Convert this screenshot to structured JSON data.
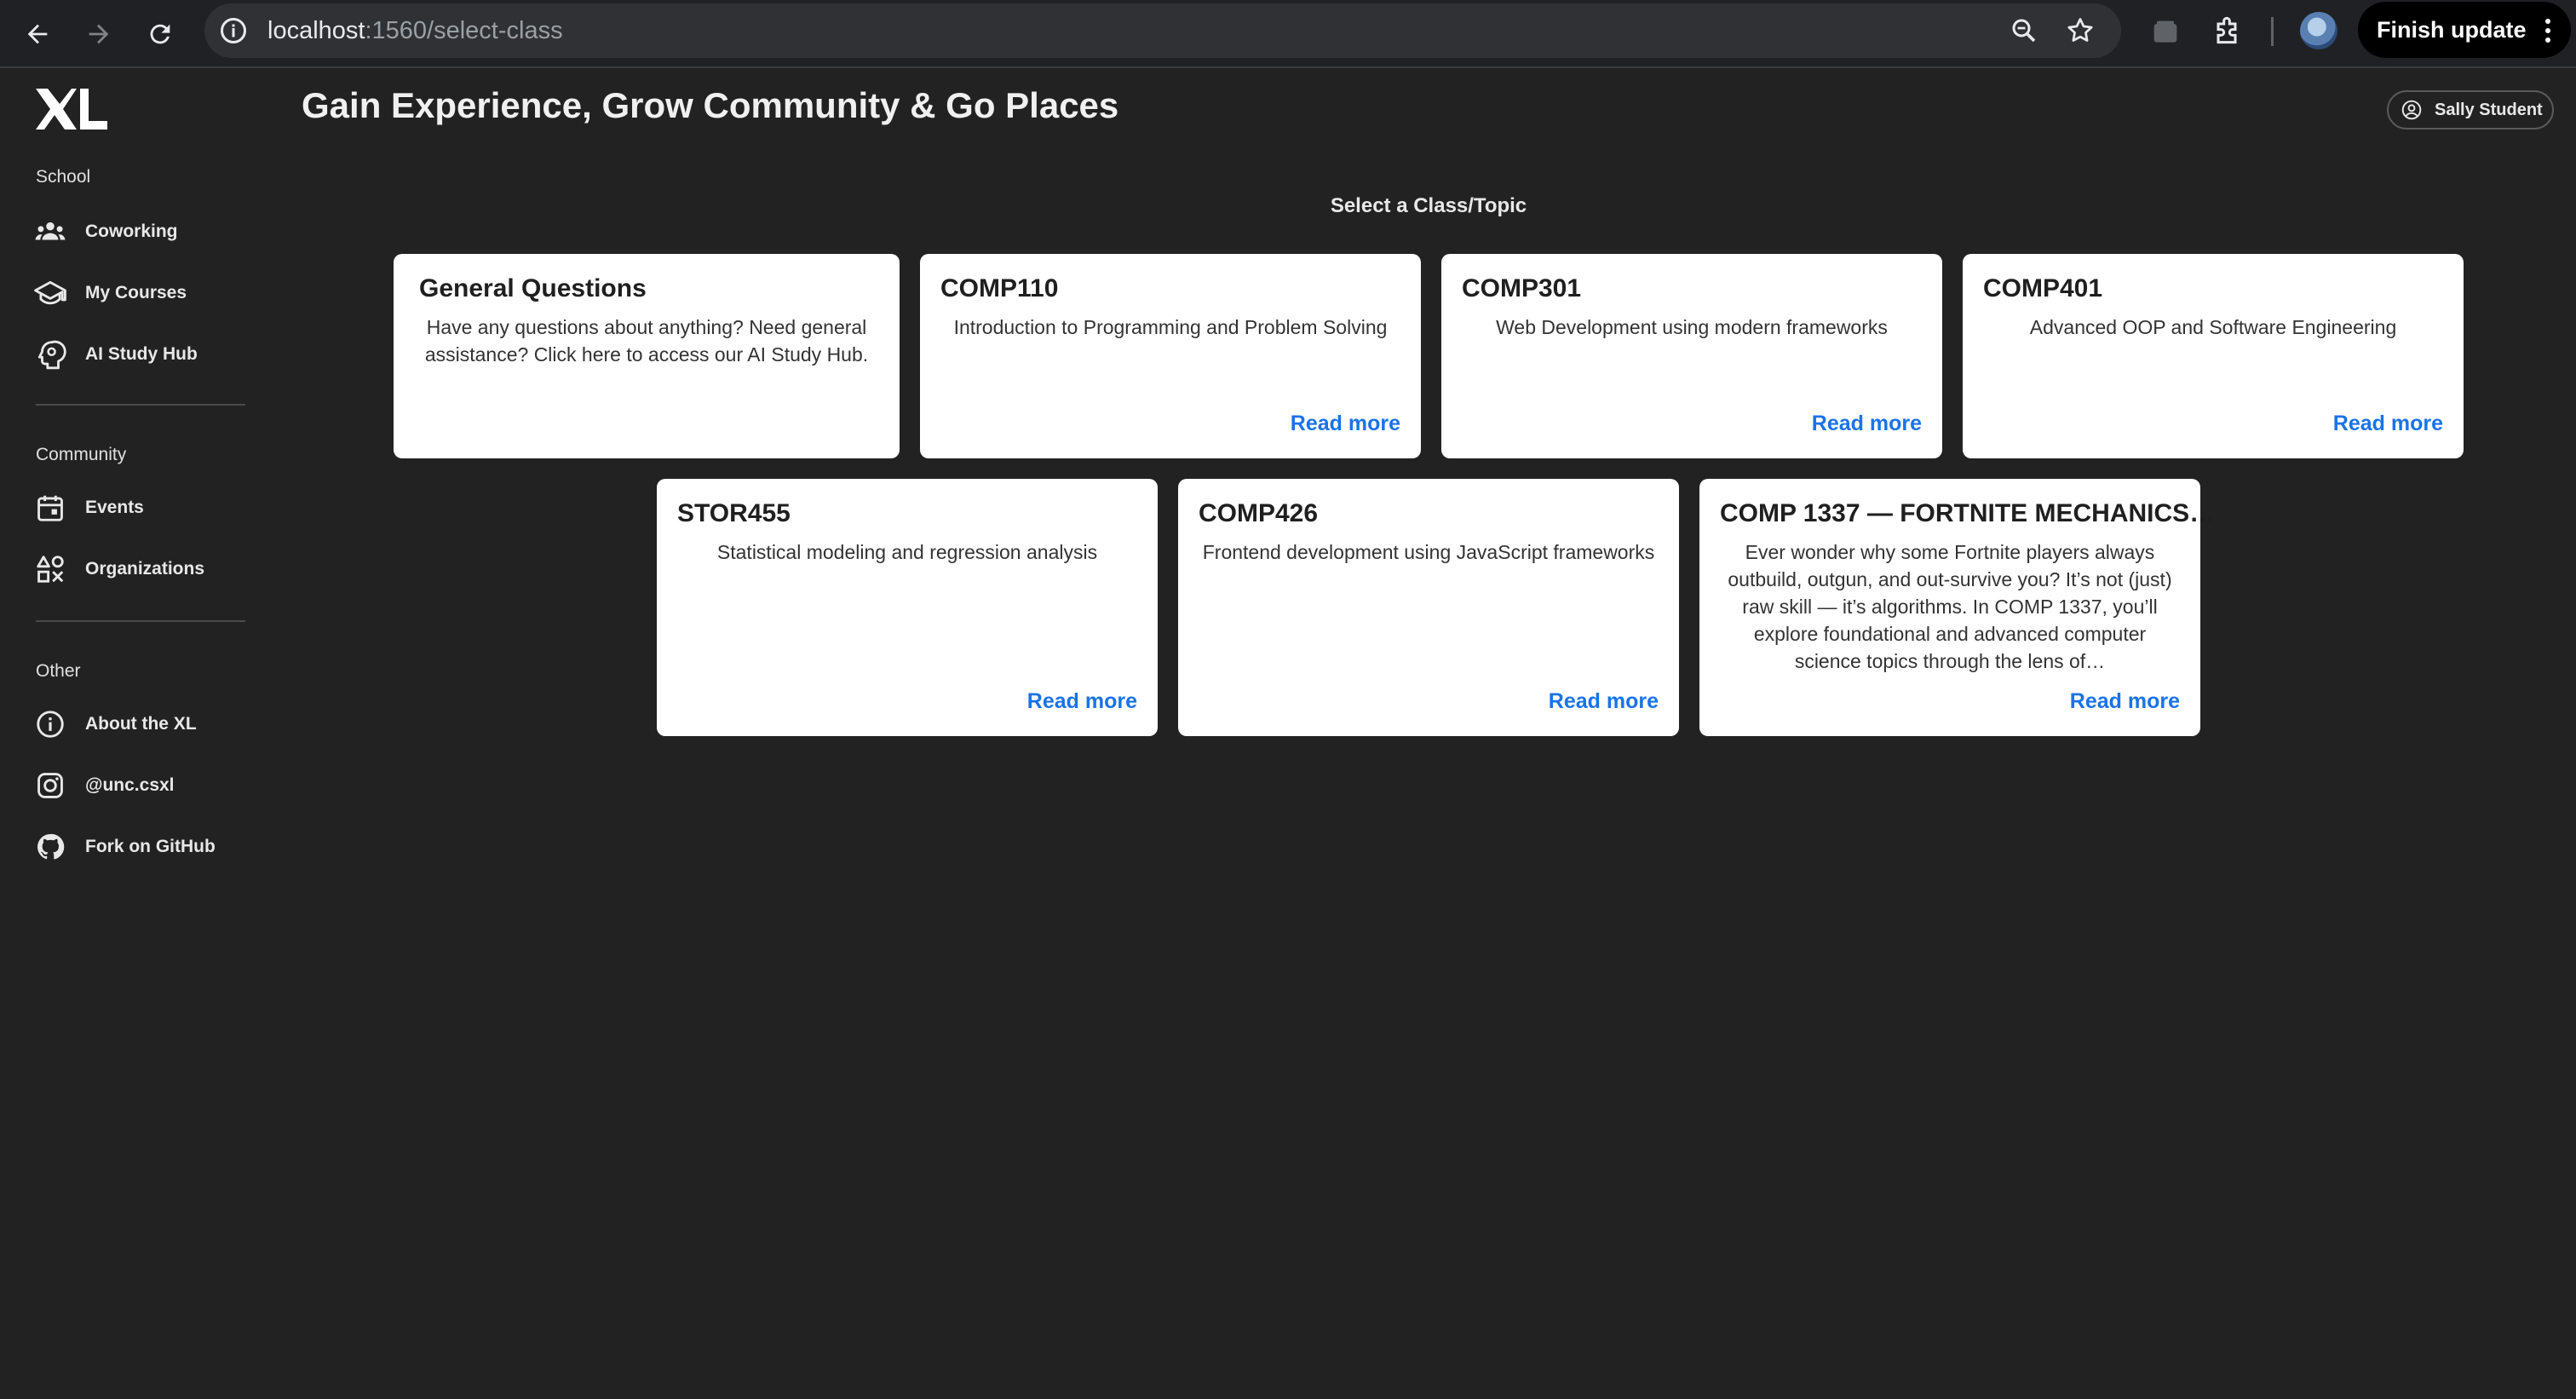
{
  "browser": {
    "url_host": "localhost",
    "url_path": ":1560/select-class",
    "finish_update_label": "Finish update",
    "icons": [
      "back-arrow-icon",
      "forward-arrow-icon",
      "reload-icon",
      "site-info-icon",
      "zoom-icon",
      "bookmark-star-icon",
      "tab-search-icon",
      "extensions-puzzle-icon",
      "profile-avatar-icon",
      "more-vert-icon"
    ]
  },
  "sidebar": {
    "sections": [
      {
        "title": "School",
        "items": [
          {
            "label": "Coworking",
            "icon": "group-icon"
          },
          {
            "label": "My Courses",
            "icon": "school-cap-icon"
          },
          {
            "label": "AI Study Hub",
            "icon": "head-bulb-icon"
          }
        ]
      },
      {
        "title": "Community",
        "items": [
          {
            "label": "Events",
            "icon": "calendar-icon"
          },
          {
            "label": "Organizations",
            "icon": "categories-icon"
          }
        ]
      },
      {
        "title": "Other",
        "items": [
          {
            "label": "About the XL",
            "icon": "info-icon"
          },
          {
            "label": "@unc.csxl",
            "icon": "instagram-icon"
          },
          {
            "label": "Fork on GitHub",
            "icon": "github-icon"
          }
        ]
      }
    ]
  },
  "header": {
    "title": "Gain Experience, Grow Community & Go Places",
    "user_name": "Sally Student"
  },
  "main": {
    "heading": "Select a Class/Topic",
    "cards": [
      {
        "title": "General Questions",
        "description": "Have any questions about anything? Need general assistance? Click here to access our AI Study Hub.",
        "read_more": ""
      },
      {
        "title": "COMP110",
        "description": "Introduction to Programming and Problem Solving",
        "read_more": "Read more"
      },
      {
        "title": "COMP301",
        "description": "Web Development using modern frameworks",
        "read_more": "Read more"
      },
      {
        "title": "COMP401",
        "description": "Advanced OOP and Software Engineering",
        "read_more": "Read more"
      },
      {
        "title": "STOR455",
        "description": "Statistical modeling and regression analysis",
        "read_more": "Read more"
      },
      {
        "title": "COMP426",
        "description": "Frontend development using JavaScript frameworks",
        "read_more": "Read more"
      },
      {
        "title": "COMP 1337 — FORTNITE MECHANICS…",
        "description": "Ever wonder why some Fortnite players always outbuild, outgun, and out-survive you? It’s not (just) raw skill — it’s algorithms. In COMP 1337, you’ll explore foundational and advanced computer science topics through the lens of…",
        "read_more": "Read more"
      }
    ]
  },
  "colors": {
    "background": "#222222",
    "card": "#ffffff",
    "link": "#1a73e8",
    "chrome": "#202124"
  }
}
